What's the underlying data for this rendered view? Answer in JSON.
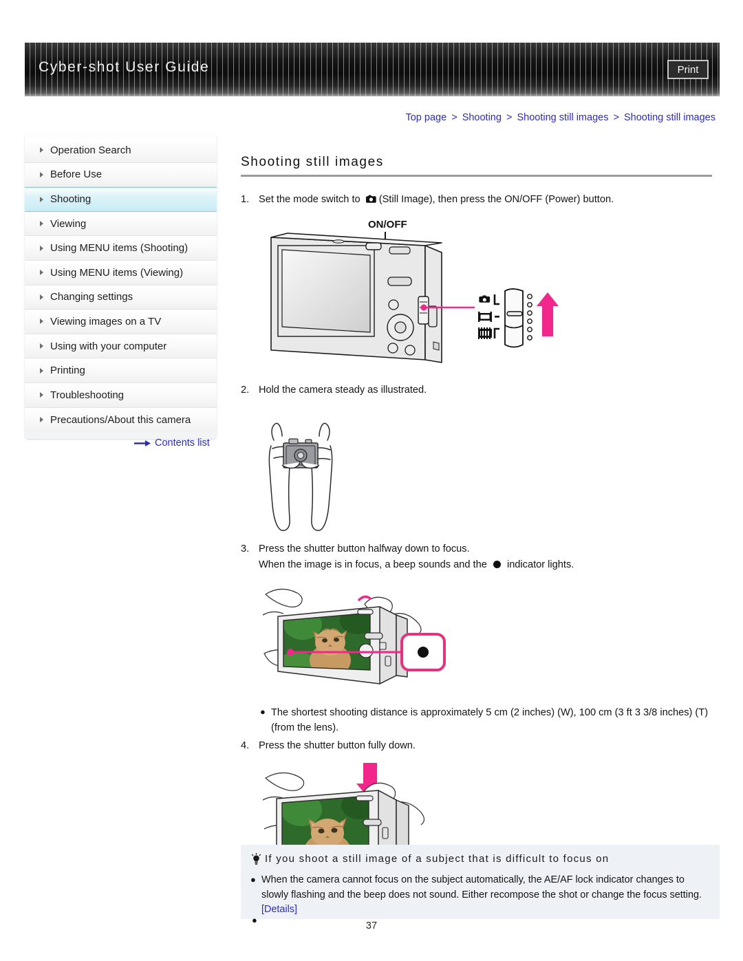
{
  "header": {
    "title": "Cyber-shot User Guide",
    "print_label": "Print"
  },
  "breadcrumb": {
    "items": [
      "Top page",
      "Shooting",
      "Shooting still images",
      "Shooting still images"
    ],
    "separator": ">"
  },
  "sidebar": {
    "items": [
      {
        "label": "Operation Search",
        "active": false
      },
      {
        "label": "Before Use",
        "active": false
      },
      {
        "label": "Shooting",
        "active": true
      },
      {
        "label": "Viewing",
        "active": false
      },
      {
        "label": "Using MENU items (Shooting)",
        "active": false
      },
      {
        "label": "Using MENU items (Viewing)",
        "active": false
      },
      {
        "label": "Changing settings",
        "active": false
      },
      {
        "label": "Viewing images on a TV",
        "active": false
      },
      {
        "label": "Using with your computer",
        "active": false
      },
      {
        "label": "Printing",
        "active": false
      },
      {
        "label": "Troubleshooting",
        "active": false
      },
      {
        "label": "Precautions/About this camera",
        "active": false
      }
    ],
    "contents_link": "Contents list"
  },
  "main": {
    "heading": "Shooting still images",
    "step1": {
      "num": "1.",
      "text_before": "Set the mode switch to",
      "text_after": "(Still Image), then press the ON/OFF (Power) button.",
      "figure_label_onoff": "ON/OFF"
    },
    "step2": {
      "num": "2.",
      "text": "Hold the camera steady as illustrated."
    },
    "step3": {
      "num": "3.",
      "line1": "Press the shutter button halfway down to focus.",
      "line2_before": "When the image is in focus, a beep sounds and the",
      "line2_after": "indicator lights."
    },
    "note_bullet": {
      "marker": "●",
      "text": "The shortest shooting distance is approximately 5 cm (2 inches) (W), 100 cm (3 ft 3 3/8 inches) (T) (from the lens)."
    },
    "step4": {
      "num": "4.",
      "text": "Press the shutter button fully down."
    }
  },
  "tip": {
    "heading": "If you shoot a still image of a subject that is difficult to focus on",
    "bullet_marker": "●",
    "bullet_text": "When the camera cannot focus on the subject automatically, the AE/AF lock indicator changes to slowly flashing and the beep does not sound. Either recompose the shot or change the focus setting.",
    "details_label": "[Details]"
  },
  "footer": {
    "page_number": "37"
  },
  "colors": {
    "link_blue": "#2b2bc4",
    "accent_pink": "#f3268c",
    "sidebar_active": "#c8ecf5",
    "tip_background": "#eef1f5"
  }
}
